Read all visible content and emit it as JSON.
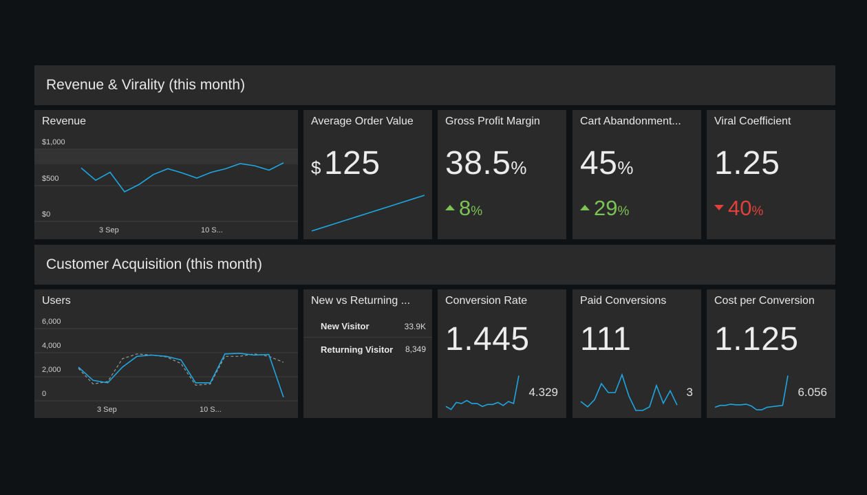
{
  "sections": {
    "revenue": {
      "title": "Revenue & Virality (this month)"
    },
    "acquisition": {
      "title": "Customer Acquisition (this month)"
    }
  },
  "colors": {
    "line": "#1ea7e1",
    "up": "#7cc355",
    "down": "#e0413b",
    "tile": "#2a2a2a",
    "background": "#0f1214"
  },
  "revenue_chart": {
    "title": "Revenue",
    "y_ticks": [
      "$1,000",
      "$500",
      "$0"
    ],
    "x_ticks": [
      "3 Sep",
      "10 S..."
    ]
  },
  "aov": {
    "title": "Average Order Value",
    "prefix": "$",
    "value": "125"
  },
  "gpm": {
    "title": "Gross Profit Margin",
    "value": "38.5",
    "unit": "%",
    "delta": "8",
    "delta_unit": "%",
    "direction": "up"
  },
  "cart": {
    "title": "Cart Abandonment...",
    "value": "45",
    "unit": "%",
    "delta": "29",
    "delta_unit": "%",
    "direction": "up"
  },
  "viral": {
    "title": "Viral Coefficient",
    "value": "1.25",
    "delta": "40",
    "delta_unit": "%",
    "direction": "down"
  },
  "users_chart": {
    "title": "Users",
    "y_ticks": [
      "6,000",
      "4,000",
      "2,000",
      "0"
    ],
    "x_ticks": [
      "3 Sep",
      "10 S..."
    ]
  },
  "nvr": {
    "title": "New vs Returning ...",
    "rows": [
      {
        "label": "New Visitor",
        "value": "33.9K"
      },
      {
        "label": "Returning Visitor",
        "value": "8,349"
      }
    ]
  },
  "conversion": {
    "title": "Conversion Rate",
    "value": "1.445",
    "spark_value": "4.329"
  },
  "paid": {
    "title": "Paid Conversions",
    "value": "111",
    "spark_value": "3"
  },
  "cpc": {
    "title": "Cost per Conversion",
    "value": "1.125",
    "spark_value": "6.056"
  },
  "chart_data": [
    {
      "type": "line",
      "title": "Revenue",
      "ylim": [
        0,
        1000
      ],
      "y_ticks": [
        "$1,000",
        "$500",
        "$0"
      ],
      "x_ticks": [
        "3 Sep",
        "10 S..."
      ],
      "series": [
        {
          "values": [
            740,
            570,
            680,
            410,
            510,
            650,
            730,
            670,
            600,
            680,
            730,
            800,
            770,
            710,
            810
          ]
        }
      ]
    },
    {
      "type": "line",
      "title": "Average Order Value",
      "series": [
        {
          "values": [
            0,
            0.1,
            0.2,
            0.3,
            0.4,
            0.5,
            0.6,
            0.7,
            0.8,
            0.9,
            1.0
          ]
        }
      ]
    },
    {
      "type": "line",
      "title": "Users",
      "ylim": [
        0,
        6000
      ],
      "y_ticks": [
        "6,000",
        "4,000",
        "2,000",
        "0"
      ],
      "x_ticks": [
        "3 Sep",
        "10 S..."
      ],
      "series": [
        {
          "style": "solid",
          "values": [
            2800,
            1700,
            1500,
            2800,
            3700,
            3800,
            3700,
            3400,
            1500,
            1500,
            3900,
            3950,
            3800,
            3850,
            300
          ]
        },
        {
          "style": "dashed",
          "values": [
            2700,
            1400,
            1600,
            3500,
            3900,
            3800,
            3650,
            3100,
            1300,
            1400,
            3700,
            3700,
            3900,
            3700,
            3200
          ]
        }
      ]
    },
    {
      "type": "line",
      "title": "Conversion Rate",
      "series": [
        {
          "values": [
            1.2,
            0.9,
            1.6,
            1.5,
            1.8,
            1.5,
            1.5,
            1.2,
            1.4,
            1.4,
            1.6,
            1.3,
            1.7,
            1.5,
            4.3
          ]
        }
      ]
    },
    {
      "type": "line",
      "title": "Paid Conversions",
      "series": [
        {
          "values": [
            1.5,
            1.2,
            1.6,
            2.5,
            2.0,
            2.0,
            3.0,
            1.8,
            1.0,
            1.0,
            1.2,
            2.4,
            1.4,
            2.1,
            1.3
          ]
        }
      ]
    },
    {
      "type": "line",
      "title": "Cost per Conversion",
      "series": [
        {
          "values": [
            1.0,
            1.3,
            1.3,
            1.5,
            1.4,
            1.4,
            1.5,
            1.2,
            0.6,
            0.6,
            1.0,
            1.1,
            1.2,
            1.3,
            6.056
          ]
        }
      ]
    }
  ]
}
